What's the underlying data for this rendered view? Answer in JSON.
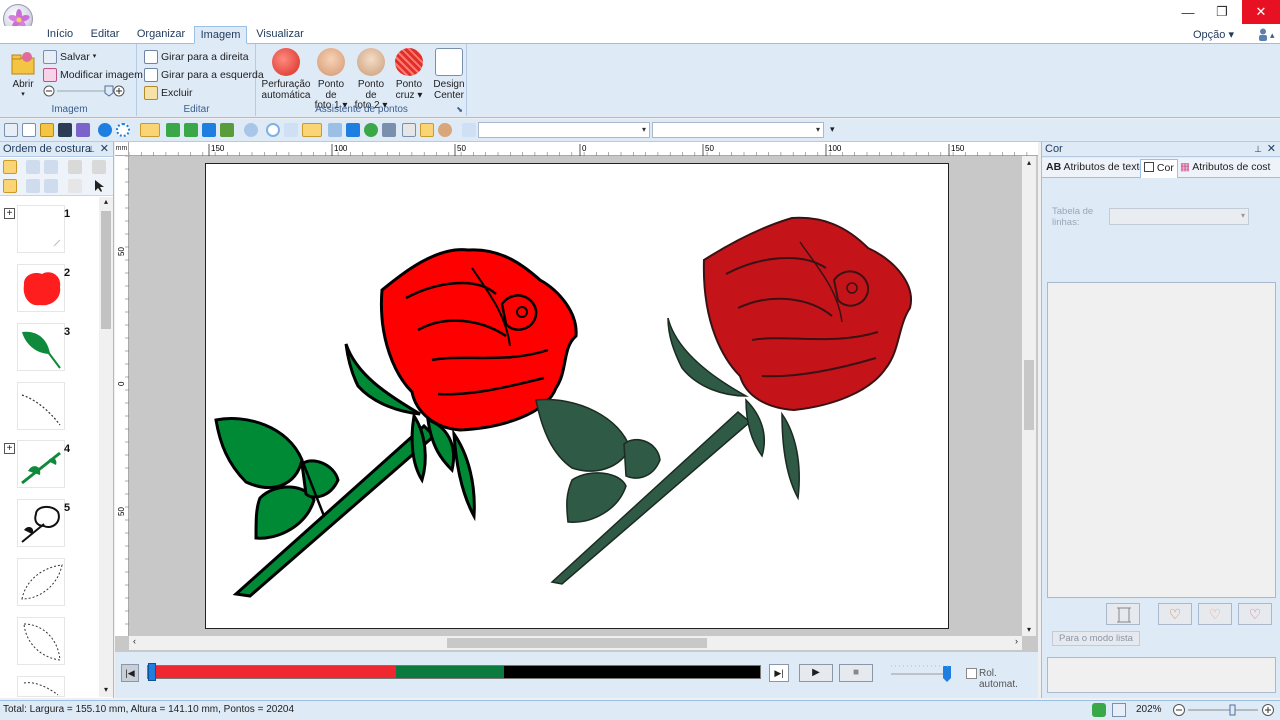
{
  "tabs": [
    "Início",
    "Editar",
    "Organizar",
    "Imagem",
    "Visualizar"
  ],
  "active_tab": "Imagem",
  "option_label": "Opção",
  "ribbon": {
    "imagem_group": {
      "open_label": "Abrir",
      "save_label": "Salvar",
      "modify_label": "Modificar imagem",
      "group_label": "Imagem"
    },
    "editar_group": {
      "rotate_right": "Girar para a direita",
      "rotate_left": "Girar para a esquerda",
      "delete": "Excluir",
      "group_label": "Editar"
    },
    "assistant_group": {
      "auto_punch_1": "Perfuração",
      "auto_punch_2": "automática",
      "photo1_1": "Ponto de",
      "photo1_2": "foto 1",
      "photo2_1": "Ponto de",
      "photo2_2": "foto 2",
      "cross_1": "Ponto",
      "cross_2": "cruz",
      "group_label": "Assistente de pontos"
    },
    "design_center_1": "Design",
    "design_center_2": "Center"
  },
  "left_panel": {
    "title": "Ordem de costura",
    "items": [
      {
        "num": "1",
        "expand": "+"
      },
      {
        "num": "2",
        "expand": ""
      },
      {
        "num": "3",
        "expand": ""
      },
      {
        "num": "",
        "expand": ""
      },
      {
        "num": "4",
        "expand": "+"
      },
      {
        "num": "5",
        "expand": ""
      },
      {
        "num": "",
        "expand": ""
      },
      {
        "num": "",
        "expand": ""
      },
      {
        "num": "",
        "expand": ""
      }
    ]
  },
  "ruler": {
    "h_labels": [
      "150",
      "100",
      "50",
      "0",
      "50",
      "100",
      "150"
    ],
    "v_labels": [
      "50",
      "0",
      "50"
    ]
  },
  "playback": {
    "auto_scroll": "Rol. automat."
  },
  "right_panel": {
    "title": "Cor",
    "tab_text_attr": "Atributos de texto",
    "tab_color": "Cor",
    "tab_sew_attr": "Atributos de cost",
    "thread_table_label": "Tabela de linhas:",
    "list_mode_button": "Para o modo lista"
  },
  "status": {
    "info": "Total: Largura = 155.10 mm, Altura = 141.10 mm, Pontos = 20204",
    "zoom": "202%"
  },
  "colors": {
    "red": "#ff0000",
    "green": "#008a36",
    "dark_red": "#c4141a",
    "dark_green": "#2f5a45",
    "ribbon_bg": "#dfeaf7"
  }
}
